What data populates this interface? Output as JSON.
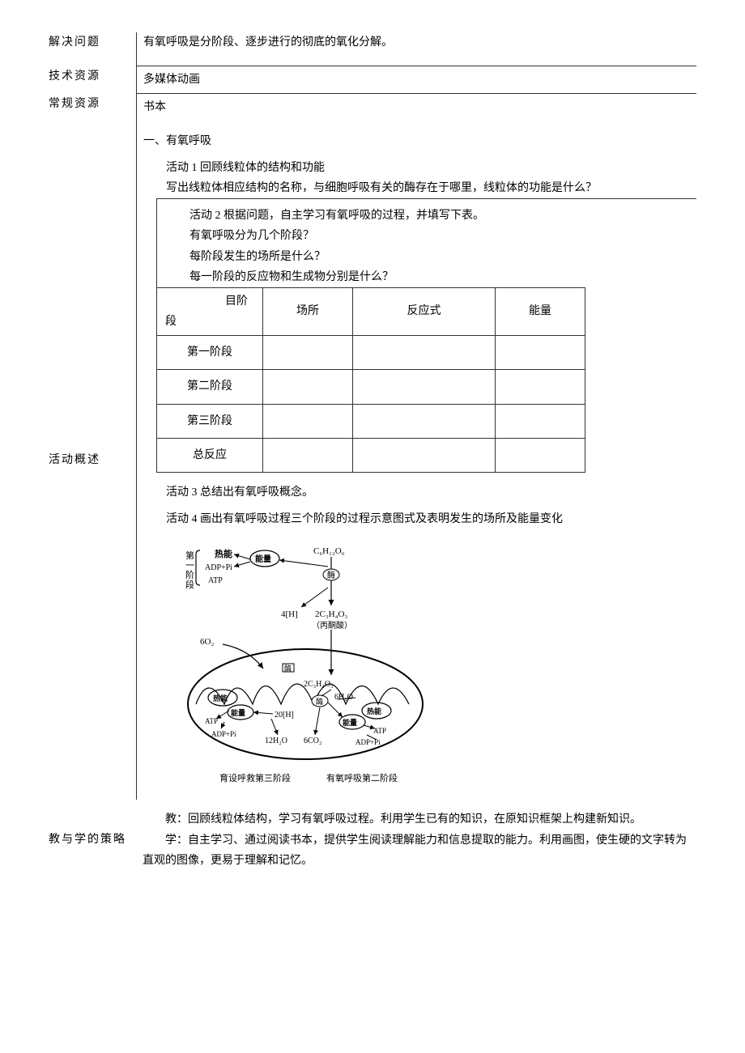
{
  "rows": {
    "solve_problem_label": "解决问题",
    "solve_problem_text": "有氧呼吸是分阶段、逐步进行的彻底的氧化分解。",
    "tech_resource_label": "技术资源",
    "tech_resource_text": "多媒体动画",
    "normal_resource_label": "常规资源",
    "normal_resource_text": "书本",
    "activity_overview_label": "活动概述",
    "strategy_label": "教与学的策略"
  },
  "section": {
    "heading": "一、有氧呼吸",
    "activity1_title": "活动 1 回顾线粒体的结构和功能",
    "activity1_text": "写出线粒体相应结构的名称，与细胞呼吸有关的酶存在于哪里，线粒体的功能是什么？",
    "activity2_title": "活动 2 根据问题，自主学习有氧呼吸的过程，并填写下表。",
    "q1": "有氧呼吸分为几个阶段？",
    "q2": "每阶段发生的场所是什么？",
    "q3": "每一阶段的反应物和生成物分别是什么？",
    "activity3_text": "活动 3 总结出有氧呼吸概念。",
    "activity4_text": "活动 4 画出有氧呼吸过程三个阶段的过程示意图式及表明发生的场所及能量变化"
  },
  "table": {
    "header_item_top": "目阶",
    "header_item_bot": "段",
    "header_place": "场所",
    "header_reaction": "反应式",
    "header_energy": "能量",
    "row1": "第一阶段",
    "row2": "第二阶段",
    "row3": "第三阶段",
    "row4": "总反应"
  },
  "diagram": {
    "stage1_label": "第一阶段",
    "heat1": "热能",
    "adp_pi1": "ADP+Pi",
    "atp1": "ATP",
    "energy": "能量",
    "enzyme": "酶",
    "glucose": "C₆H₁₂O₆",
    "fourH": "4[H]",
    "pyruvate_formula": "2C₃H₄O₃",
    "pyruvate_name": "（丙酮酸）",
    "sixO2": "6O₂",
    "heat2": "热能",
    "energy2": "能量",
    "atp2": "ATP",
    "adp_pi2": "ADP+Pi",
    "twentyH": "20[H]",
    "twelveH2O": "12H₂O",
    "sixCO2": "6CO₂",
    "pyruvate2": "2C₃H₄O₃",
    "enzyme2": "酶",
    "sixH2O": "6H₂O",
    "heat3": "热能",
    "energy3": "能量",
    "atp3": "ATP",
    "adp_pi3": "ADP+Pi",
    "caption_left": "育设呼救第三阶段",
    "caption_right": "有氧呼吸第二阶段"
  },
  "strategy": {
    "teach": "教：回顾线粒体结构，学习有氧呼吸过程。利用学生已有的知识，在原知识框架上构建新知识。",
    "learn": "学：自主学习、通过阅读书本，提供学生阅读理解能力和信息提取的能力。利用画图，使生硬的文字转为直观的图像，更易于理解和记忆。"
  }
}
